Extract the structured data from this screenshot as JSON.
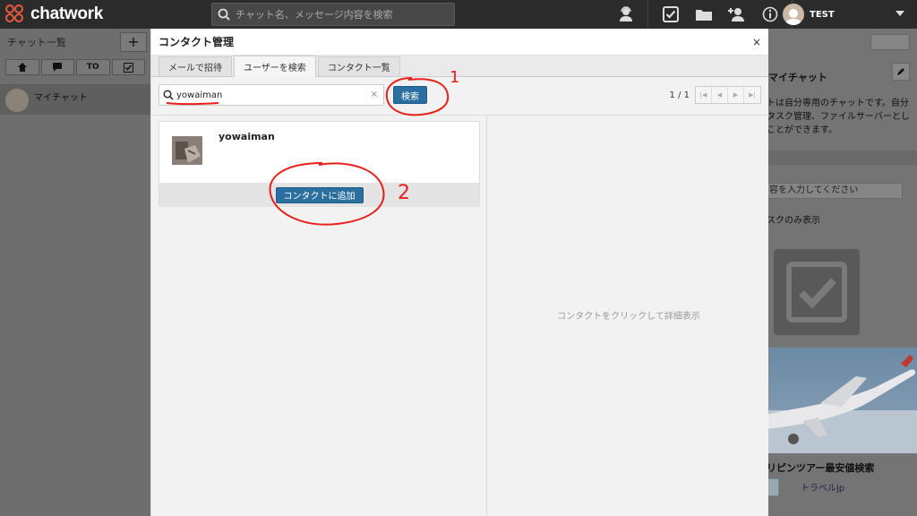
{
  "app": {
    "brand": "chatwork"
  },
  "header": {
    "search_placeholder": "チャット名、メッセージ内容を検索",
    "username": "TEST"
  },
  "sidebar": {
    "title": "チャット一覧",
    "add_label": "+",
    "tools": [
      "",
      "",
      "TO",
      ""
    ],
    "items": [
      {
        "label": "マイチャット"
      }
    ]
  },
  "right_panel": {
    "title": "マイチャット",
    "description_lines": [
      "トは自分専用のチャットです。自分",
      "タスク管理、ファイルサーバーとし",
      "ことができます。"
    ],
    "task_placeholder": "容を入力してください",
    "filter_label": "スクのみ表示",
    "ad_title": "リピンツアー最安値検索",
    "ad_source": "トラベルjp"
  },
  "modal": {
    "title": "コンタクト管理",
    "close_label": "×",
    "tabs": [
      {
        "label": "メールで招待",
        "active": false
      },
      {
        "label": "ユーザーを検索",
        "active": true
      },
      {
        "label": "コンタクト一覧",
        "active": false
      }
    ],
    "search_value": "yowaiman",
    "clear_label": "×",
    "search_button": "検索",
    "pager": "1 / 1",
    "results": [
      {
        "name": "yowaiman",
        "action": "コンタクトに追加"
      }
    ],
    "detail_placeholder": "コンタクトをクリックして詳細表示"
  },
  "annotations": {
    "step1": "1",
    "step2": "2",
    "color": "#e8201a"
  },
  "colors": {
    "topbar": "#2b2b2b",
    "accent": "#2a6fa0",
    "brand_mark": "#e55a3c"
  }
}
